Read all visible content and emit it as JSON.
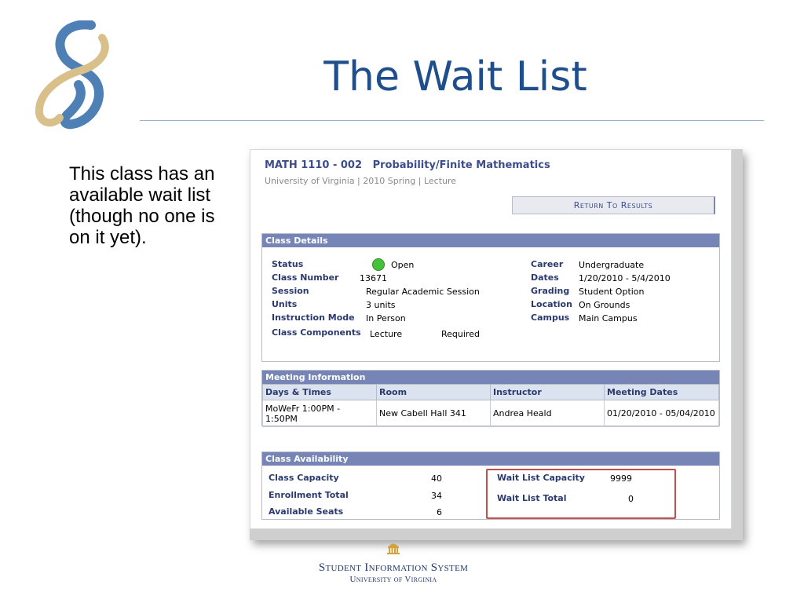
{
  "slide": {
    "title": "The Wait List",
    "bullet": "This class has an available wait list (though no one is on it yet)."
  },
  "course": {
    "title": "MATH 1110 - 002   Probability/Finite Mathematics",
    "subtitle": "University of Virginia | 2010 Spring | Lecture",
    "return_label": "Return To Results"
  },
  "class_details": {
    "header": "Class Details",
    "left": [
      {
        "label": "Status",
        "value": "Open"
      },
      {
        "label": "Class Number",
        "value": "13671"
      },
      {
        "label": "Session",
        "value": "Regular Academic Session"
      },
      {
        "label": "Units",
        "value": "3 units"
      },
      {
        "label": "Instruction Mode",
        "value": "In Person"
      },
      {
        "label": "Class Components",
        "value": "Lecture",
        "value2": "Required"
      }
    ],
    "right": [
      {
        "label": "Career",
        "value": "Undergraduate"
      },
      {
        "label": "Dates",
        "value": "1/20/2010 - 5/4/2010"
      },
      {
        "label": "Grading",
        "value": "Student Option"
      },
      {
        "label": "Location",
        "value": "On Grounds"
      },
      {
        "label": "Campus",
        "value": "Main Campus"
      }
    ],
    "status_color": "#46c23a"
  },
  "meeting": {
    "header": "Meeting Information",
    "columns": [
      "Days & Times",
      "Room",
      "Instructor",
      "Meeting Dates"
    ],
    "rows": [
      [
        "MoWeFr 1:00PM - 1:50PM",
        "New Cabell Hall 341",
        "Andrea Heald",
        "01/20/2010 - 05/04/2010"
      ]
    ]
  },
  "availability": {
    "header": "Class Availability",
    "left": [
      {
        "label": "Class Capacity",
        "value": "40"
      },
      {
        "label": "Enrollment Total",
        "value": "34"
      },
      {
        "label": "Available Seats",
        "value": "6"
      }
    ],
    "right": [
      {
        "label": "Wait List Capacity",
        "value": "9999"
      },
      {
        "label": "Wait List Total",
        "value": "0"
      }
    ],
    "highlight_color": "#c0504d"
  },
  "footer": {
    "line1": "Student Information System",
    "line2": "University of Virginia"
  }
}
